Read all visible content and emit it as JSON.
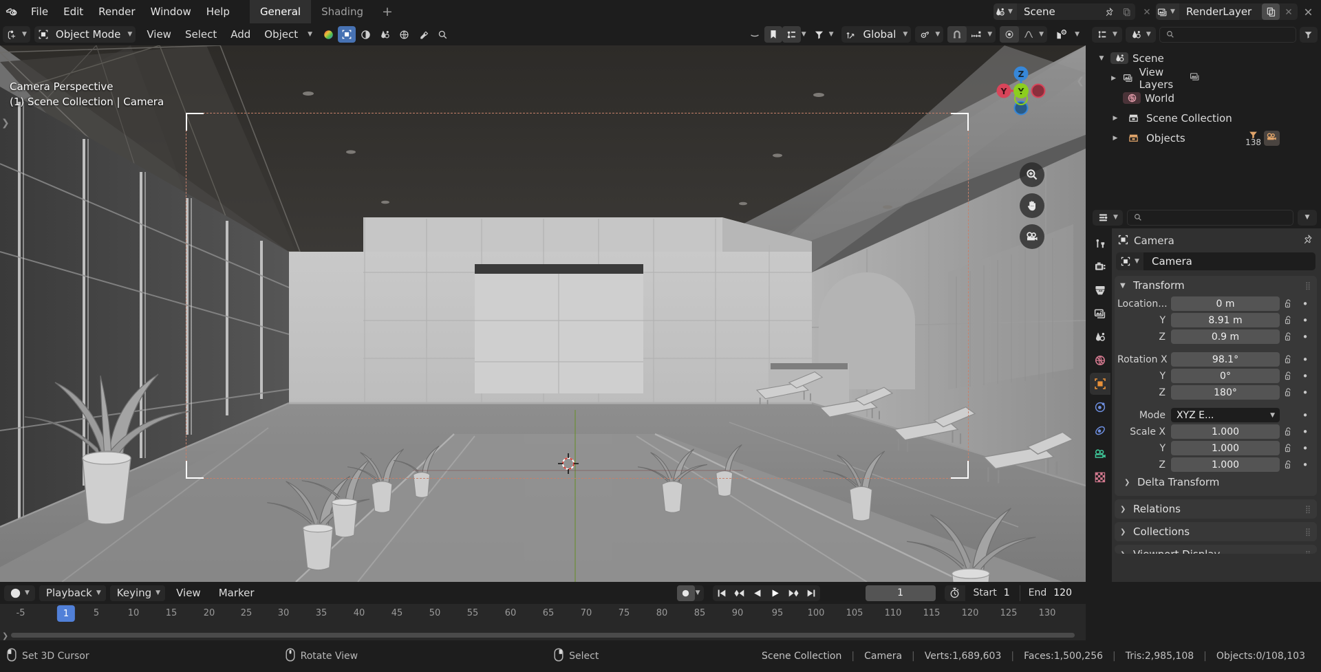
{
  "topbar": {
    "logo_icon": "blender-logo-icon",
    "menus": [
      "File",
      "Edit",
      "Render",
      "Window",
      "Help"
    ],
    "workspaces": [
      {
        "label": "General",
        "active": true
      },
      {
        "label": "Shading",
        "active": false
      }
    ],
    "add_workspace_label": "+",
    "scene": {
      "icon": "scene-icon",
      "name": "Scene",
      "pin_icon": "pin-icon",
      "new_icon": "new-scene-icon",
      "close_icon": "close-icon"
    },
    "viewlayer": {
      "icon": "renderlayers-icon",
      "name": "RenderLayer",
      "copy_icon": "duplicate-icon",
      "close_icon": "close-icon"
    }
  },
  "viewport": {
    "header": {
      "editor_type_icon": "editor-type-3dview-icon",
      "mode_icon": "object-mode-icon",
      "mode_label": "Object Mode",
      "menus": [
        "View",
        "Select",
        "Add",
        "Object"
      ],
      "transform_orientation": "Global",
      "orientation_icon": "orientation-icon",
      "snap_icon": "snap-magnet-icon",
      "snap_target_icon": "snap-increment-icon",
      "pivot_icon": "pivot-point-icon",
      "proportional_icon": "proportional-editing-icon",
      "shading_modes": [
        "wireframe",
        "solid",
        "material-preview",
        "rendered"
      ],
      "active_shading": "solid",
      "gizmo_icon": "gizmo-icon",
      "overlays_icon": "overlays-icon",
      "xray_icon": "xray-icon",
      "visibility_icon": "visibility-icon",
      "filter_icon": "filter-icon",
      "search_icon": "search-icon",
      "select_mode_icon": "select-box-icon"
    },
    "overlay_line_1": "Camera Perspective",
    "overlay_line_2": "(1) Scene Collection | Camera",
    "nav_gizmo": {
      "axes": [
        {
          "label": "X",
          "color": "#e0536a"
        },
        {
          "label": "Y",
          "color": "#8cce1e"
        },
        {
          "label": "Z",
          "color": "#3787d8"
        }
      ]
    },
    "nav_buttons": [
      {
        "icon": "zoom-icon",
        "name": "zoom-view-button"
      },
      {
        "icon": "hand-icon",
        "name": "pan-view-button"
      },
      {
        "icon": "camera-icon",
        "name": "camera-view-button"
      }
    ],
    "scene_description": "Clay-shaded interior architectural render: long corridor / pool hall with glass curtain wall on left, tiled back wall, potted monstera plants along both sides and sun loungers on the right"
  },
  "outliner": {
    "display_mode_icon": "outliner-display-mode-icon",
    "filter_scene_icon": "scene-filter-icon",
    "search_placeholder": "",
    "search_icon": "search-icon",
    "filter_icon": "filter-icon",
    "items": [
      {
        "label": "Scene",
        "icon": "scene-icon",
        "depth": 0,
        "disclosure": "open",
        "badges": []
      },
      {
        "label": "View Layers",
        "icon": "renderlayers-icon",
        "depth": 1,
        "disclosure": "closed",
        "badges": [
          "renderlayers-icon"
        ]
      },
      {
        "label": "World",
        "icon": "world-icon",
        "depth": 1,
        "disclosure": "none",
        "badges": []
      },
      {
        "label": "Scene Collection",
        "icon": "collection-icon",
        "depth": 1,
        "disclosure": "closed",
        "badges": []
      },
      {
        "label": "Objects",
        "icon": "objects-collection-icon",
        "depth": 1,
        "disclosure": "closed",
        "badges": [
          "mesh-icon",
          "camera-icon"
        ],
        "count": "138"
      }
    ]
  },
  "properties": {
    "editor_icon": "properties-editor-icon",
    "search_placeholder": "",
    "search_icon": "search-icon",
    "filter_icon": "filter-dropdown-icon",
    "tabs": [
      {
        "name": "tool",
        "icon": "tool-icon",
        "active": false
      },
      {
        "name": "render",
        "icon": "render-camera-icon",
        "active": false
      },
      {
        "name": "output",
        "icon": "printer-output-icon",
        "active": false
      },
      {
        "name": "view-layer",
        "icon": "viewlayer-images-icon",
        "active": false
      },
      {
        "name": "scene",
        "icon": "scene-icon",
        "active": false
      },
      {
        "name": "world",
        "icon": "world-icon",
        "active": false
      },
      {
        "name": "object",
        "icon": "object-properties-icon",
        "active": true
      },
      {
        "name": "modifiers",
        "icon": "constraints-icon",
        "active": false
      },
      {
        "name": "physics",
        "icon": "physics-icon",
        "active": false
      },
      {
        "name": "object-data",
        "icon": "camera-data-icon",
        "active": false
      },
      {
        "name": "texture",
        "icon": "texture-checker-icon",
        "active": false
      }
    ],
    "breadcrumb": {
      "icon": "object-properties-icon",
      "label": "Camera",
      "pin_icon": "pin-icon"
    },
    "id_block": {
      "icon": "object-properties-icon",
      "name": "Camera"
    },
    "transform_panel": {
      "title": "Transform",
      "open": true,
      "rows": [
        {
          "label": "Location...",
          "value": "0 m",
          "type": "number",
          "lock": "unlocked",
          "anim": "dot"
        },
        {
          "label": "Y",
          "value": "8.91 m",
          "type": "number",
          "lock": "unlocked",
          "anim": "dot"
        },
        {
          "label": "Z",
          "value": "0.9 m",
          "type": "number",
          "lock": "unlocked",
          "anim": "dot"
        },
        {
          "label": "Rotation X",
          "value": "98.1°",
          "type": "number",
          "lock": "unlocked",
          "anim": "dot"
        },
        {
          "label": "Y",
          "value": "0°",
          "type": "number",
          "lock": "unlocked",
          "anim": "dot"
        },
        {
          "label": "Z",
          "value": "180°",
          "type": "number",
          "lock": "unlocked",
          "anim": "dot"
        },
        {
          "label": "Mode",
          "value": "XYZ E...",
          "type": "enum",
          "lock": "none",
          "anim": "dot"
        },
        {
          "label": "Scale X",
          "value": "1.000",
          "type": "number",
          "lock": "unlocked",
          "anim": "dot"
        },
        {
          "label": "Y",
          "value": "1.000",
          "type": "number",
          "lock": "unlocked",
          "anim": "dot"
        },
        {
          "label": "Z",
          "value": "1.000",
          "type": "number",
          "lock": "unlocked",
          "anim": "dot"
        }
      ],
      "subpanel": "Delta Transform"
    },
    "panels": [
      {
        "title": "Relations",
        "open": false
      },
      {
        "title": "Collections",
        "open": false
      },
      {
        "title": "Viewport Display",
        "open": false
      }
    ]
  },
  "timeline": {
    "editor_icon": "timeline-editor-icon",
    "menus": [
      {
        "label": "Playback",
        "dropdown": true
      },
      {
        "label": "Keying",
        "dropdown": true
      },
      {
        "label": "View",
        "dropdown": false
      },
      {
        "label": "Marker",
        "dropdown": false
      }
    ],
    "autokey_icon": "record-dot-icon",
    "playback_buttons": [
      {
        "name": "jump-to-start-button",
        "icon": "jump-start-icon"
      },
      {
        "name": "previous-keyframe-button",
        "icon": "prev-keyframe-icon"
      },
      {
        "name": "play-reverse-button",
        "icon": "play-reverse-icon"
      },
      {
        "name": "play-button",
        "icon": "play-icon"
      },
      {
        "name": "next-keyframe-button",
        "icon": "next-keyframe-icon"
      },
      {
        "name": "jump-to-end-button",
        "icon": "jump-end-icon"
      }
    ],
    "current_frame": "1",
    "use_preview_range_icon": "stopwatch-icon",
    "start_label": "Start",
    "start_value": "1",
    "end_label": "End",
    "end_value": "120",
    "ticks": [
      "-5",
      "5",
      "10",
      "15",
      "20",
      "25",
      "30",
      "35",
      "40",
      "45",
      "50",
      "55",
      "60",
      "65",
      "70",
      "75",
      "80",
      "85",
      "90",
      "95",
      "100",
      "105",
      "110",
      "115",
      "120",
      "125",
      "130"
    ],
    "playhead_frame": "1"
  },
  "statusbar": {
    "hints": [
      {
        "icon": "mouse-left-icon",
        "label": "Set 3D Cursor"
      },
      {
        "icon": "mouse-middle-icon",
        "label": "Rotate View"
      },
      {
        "icon": "mouse-right-icon",
        "label": "Select"
      }
    ],
    "stats": [
      "Scene Collection",
      "Camera",
      "Verts:1,689,603",
      "Faces:1,500,256",
      "Tris:2,985,108",
      "Objects:0/108,103"
    ]
  },
  "colors": {
    "accent_blue": "#4772b3",
    "active_orange": "#e8913a",
    "window_bg": "#1d1d1d",
    "panel_bg": "#303030",
    "field_bg": "#545454",
    "camera_frame": "#c8806a"
  }
}
